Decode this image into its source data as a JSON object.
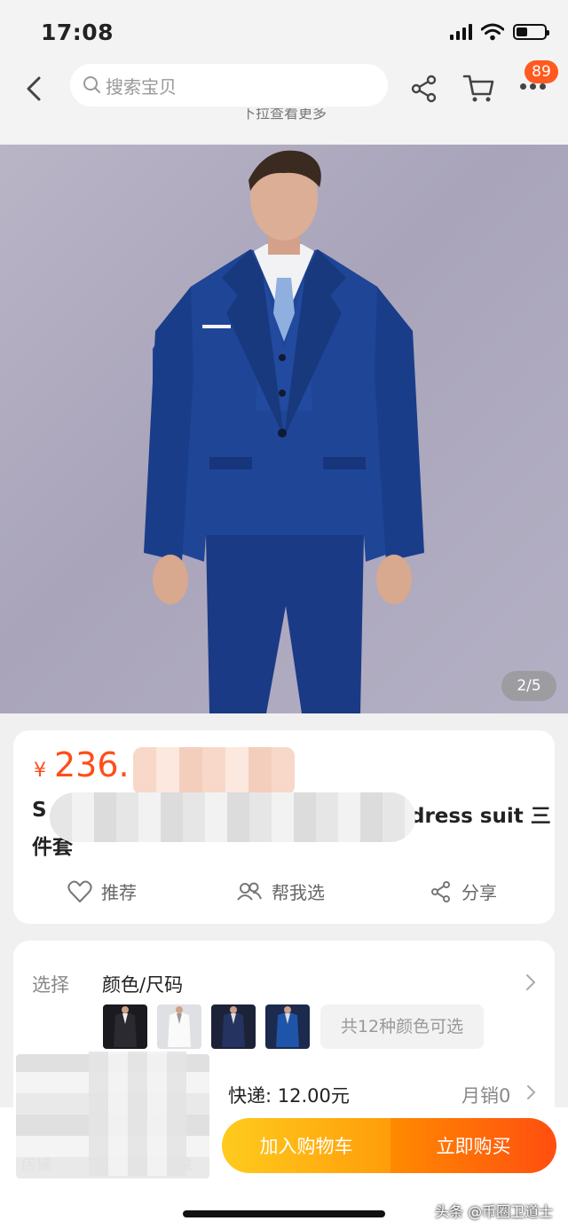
{
  "status_bar": {
    "time": "17:08"
  },
  "nav": {
    "search_placeholder": "搜索宝贝",
    "badge_count": "89",
    "pull_hint": "下拉查看更多"
  },
  "hero": {
    "image_counter": "2/5"
  },
  "product": {
    "currency_symbol": "¥",
    "price_visible": "236.",
    "title_start": "S",
    "title_end": "dress suit 三",
    "title_line2": "件套"
  },
  "actions": {
    "recommend": "推荐",
    "pick_for_me": "帮我选",
    "share": "分享"
  },
  "options": {
    "select_label": "选择",
    "select_value": "颜色/尺码",
    "color_count": "共12种颜色可选",
    "thumbnails": [
      "black",
      "white",
      "navy",
      "blue"
    ]
  },
  "shipping": {
    "delivery": "快递: 12.00元",
    "monthly_sales": "月销0"
  },
  "bottom_bar": {
    "store_label": "店铺",
    "fav_label": "藏",
    "add_to_cart": "加入购物车",
    "buy_now": "立即购买"
  },
  "watermark": "头条 @币圈卫道士",
  "colors": {
    "accent": "#ff4d1a",
    "cart_button": "#ffb515",
    "buy_button": "#ff6a0a"
  }
}
